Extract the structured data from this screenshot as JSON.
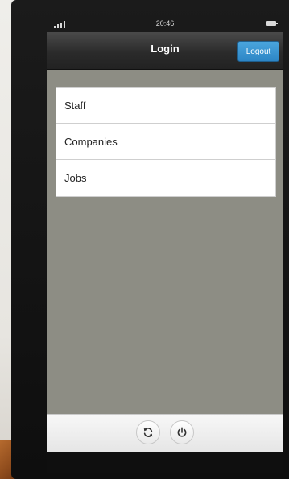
{
  "status_bar": {
    "time": "20:46"
  },
  "nav": {
    "title": "Login",
    "logout_label": "Logout"
  },
  "menu": {
    "items": [
      {
        "label": "Staff"
      },
      {
        "label": "Companies"
      },
      {
        "label": "Jobs"
      }
    ]
  },
  "footer": {
    "refresh_icon": "refresh-icon",
    "power_icon": "power-icon"
  },
  "colors": {
    "accent": "#2d86c6",
    "screen_background": "#8d8d84",
    "nav_background": "#2b2b2b"
  }
}
